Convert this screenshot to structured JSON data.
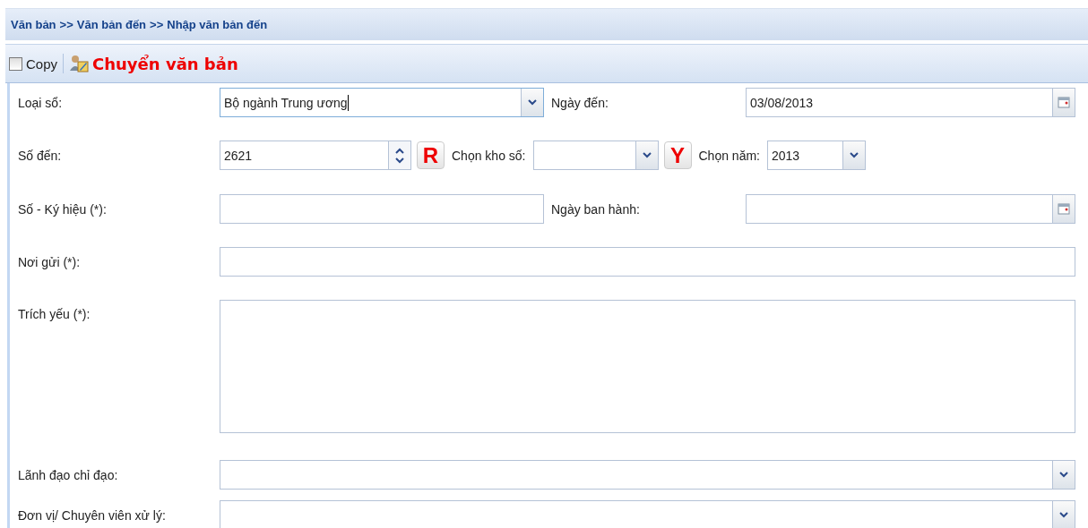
{
  "breadcrumb": [
    "Văn bản",
    ">>",
    "Văn bản đến",
    ">>",
    "Nhập văn bản đến"
  ],
  "toolbar": {
    "copy": {
      "label": "Copy",
      "checked": false
    },
    "transfer_button": "Chuyển văn bản"
  },
  "form": {
    "loai_so": {
      "label": "Loại sổ:",
      "value": "Bộ ngành Trung ương"
    },
    "ngay_den": {
      "label": "Ngày đến:",
      "value": "03/08/2013"
    },
    "so_den": {
      "label": "Số đến:",
      "value": "2621"
    },
    "reset_button": "R",
    "kho_so": {
      "label": "Chọn kho số:"
    },
    "year_button": "Y",
    "nam": {
      "label": "Chọn năm:",
      "value": "2013"
    },
    "so_ky_hieu": {
      "label": "Số - Ký hiệu (*):"
    },
    "ngay_ban_hanh": {
      "label": "Ngày ban hành:"
    },
    "noi_gui": {
      "label": "Nơi gửi (*):"
    },
    "trich_yeu": {
      "label": "Trích yếu (*):"
    },
    "lanh_dao": {
      "label": "Lãnh đạo chỉ đạo:"
    },
    "don_vi": {
      "label": "Đơn vị/ Chuyên viên xử lý:"
    }
  }
}
